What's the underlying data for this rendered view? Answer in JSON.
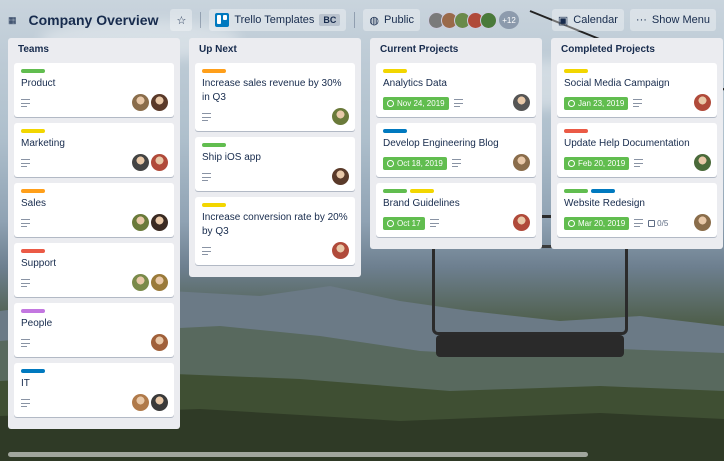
{
  "colors": {
    "green": "#61bd4f",
    "yellow": "#f2d600",
    "orange": "#ff9f1a",
    "red": "#eb5a46",
    "purple": "#c377e0",
    "blue": "#0079bf"
  },
  "header": {
    "board_icon": "icon-grid",
    "title": "Company Overview",
    "star_icon": "star-icon",
    "workspace_label": "Trello Templates",
    "workspace_tag": "BC",
    "visibility_label": "Public",
    "member_overflow": "+12",
    "calendar_label": "Calendar",
    "menu_label": "Show Menu"
  },
  "lists": [
    {
      "title": "Teams",
      "cards": [
        {
          "labels": [
            "#61bd4f"
          ],
          "title": "Product",
          "avatars": [
            "#8a6d4b",
            "#5a3a2a"
          ]
        },
        {
          "labels": [
            "#f2d600"
          ],
          "title": "Marketing",
          "avatars": [
            "#444444",
            "#b04a3a"
          ]
        },
        {
          "labels": [
            "#ff9f1a"
          ],
          "title": "Sales",
          "avatars": [
            "#6a7a3a",
            "#3a2a22"
          ]
        },
        {
          "labels": [
            "#eb5a46"
          ],
          "title": "Support",
          "avatars": [
            "#7a8a4a",
            "#9a7a3a"
          ]
        },
        {
          "labels": [
            "#c377e0"
          ],
          "title": "People",
          "avatars": [
            "#a0603a"
          ]
        },
        {
          "labels": [
            "#0079bf"
          ],
          "title": "IT",
          "avatars": [
            "#b07a4a",
            "#3a3a3a"
          ]
        }
      ]
    },
    {
      "title": "Up Next",
      "cards": [
        {
          "labels": [
            "#ff9f1a"
          ],
          "title": "Increase sales revenue by 30% in Q3",
          "avatars": [
            "#6a7a3a"
          ]
        },
        {
          "labels": [
            "#61bd4f"
          ],
          "title": "Ship iOS app",
          "avatars": [
            "#5a3a2a"
          ]
        },
        {
          "labels": [
            "#f2d600"
          ],
          "title": "Increase conversion rate by 20% by Q3",
          "avatars": [
            "#b04a3a"
          ]
        }
      ]
    },
    {
      "title": "Current Projects",
      "cards": [
        {
          "labels": [
            "#f2d600"
          ],
          "title": "Analytics Data",
          "due": "Nov 24, 2019",
          "avatars": [
            "#555555"
          ]
        },
        {
          "labels": [
            "#0079bf"
          ],
          "title": "Develop Engineering Blog",
          "due": "Oct 18, 2019",
          "avatars": [
            "#8a6d4b"
          ]
        },
        {
          "labels": [
            "#61bd4f",
            "#f2d600"
          ],
          "title": "Brand Guidelines",
          "due": "Oct 17",
          "avatars": [
            "#b04a3a"
          ]
        }
      ]
    },
    {
      "title": "Completed Projects",
      "cards": [
        {
          "labels": [
            "#f2d600"
          ],
          "title": "Social Media Campaign",
          "due": "Jan 23, 2019",
          "avatars": [
            "#b04a3a"
          ]
        },
        {
          "labels": [
            "#eb5a46"
          ],
          "title": "Update Help Documentation",
          "due": "Feb 20, 2019",
          "avatars": [
            "#4a6a3a"
          ]
        },
        {
          "labels": [
            "#61bd4f",
            "#0079bf"
          ],
          "title": "Website Redesign",
          "due": "Mar 20, 2019",
          "checklist": "0/5",
          "avatars": [
            "#8a6d4b"
          ]
        }
      ]
    }
  ]
}
